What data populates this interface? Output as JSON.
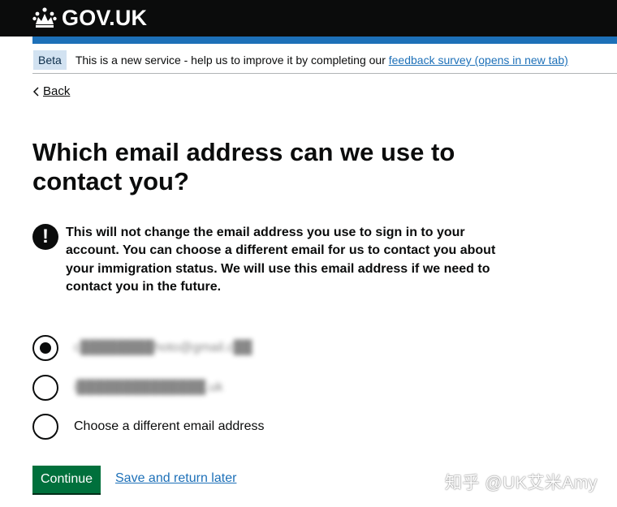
{
  "header": {
    "logo_text": "GOV.UK"
  },
  "phase_banner": {
    "tag": "Beta",
    "text": "This is a new service - help us to improve it by completing our ",
    "link_text": "feedback survey (opens in new tab)"
  },
  "back_link": "Back",
  "page_title": "Which email address can we use to contact you?",
  "warning": {
    "icon_glyph": "!",
    "text": "This will not change the email address you use to sign in to your account. You can choose a different email for us to contact you about your immigration status. We will use this email address if we need to contact you in the future."
  },
  "radios": [
    {
      "label": "c████████hoto@gmail.c██",
      "checked": true
    },
    {
      "label": "i██████████████.uk",
      "checked": false
    },
    {
      "label": "Choose a different email address",
      "checked": false
    }
  ],
  "continue_label": "Continue",
  "save_label": "Save and return later",
  "watermark": "知乎 @UK艾米Amy",
  "colors": {
    "header": "#0b0c0c",
    "blue_bar": "#1d70b8",
    "link": "#1d70b8",
    "button": "#00703c"
  }
}
